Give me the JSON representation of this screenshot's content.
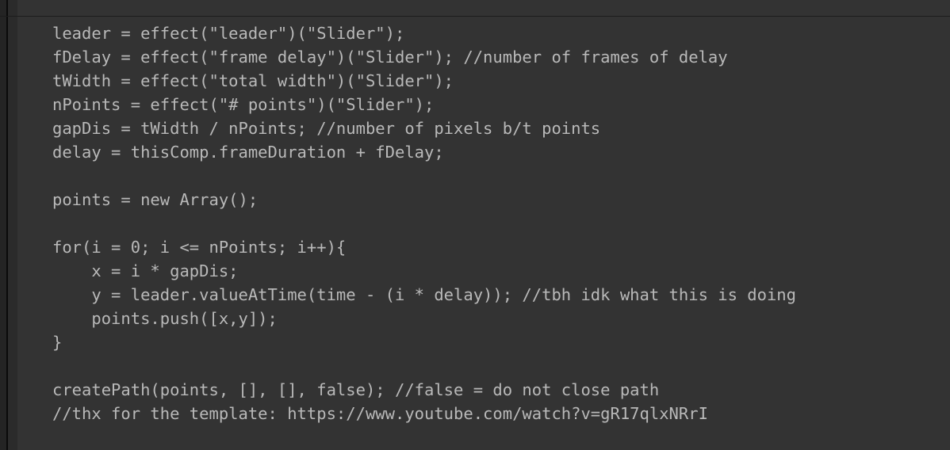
{
  "editor": {
    "language_hint": "after-effects-expression",
    "background_color": "#333333",
    "text_color": "#b9b9b9",
    "gutter_color": "#242424",
    "gutter_rule_color": "#0a0a0a",
    "gutter_inner_color": "#2b2b2b",
    "divider_color": "#1c1c1c",
    "lines": [
      "leader = effect(\"leader\")(\"Slider\");",
      "fDelay = effect(\"frame delay\")(\"Slider\"); //number of frames of delay",
      "tWidth = effect(\"total width\")(\"Slider\");",
      "nPoints = effect(\"# points\")(\"Slider\");",
      "gapDis = tWidth / nPoints; //number of pixels b/t points",
      "delay = thisComp.frameDuration + fDelay;",
      "",
      "points = new Array();",
      "",
      "for(i = 0; i <= nPoints; i++){",
      "    x = i * gapDis;",
      "    y = leader.valueAtTime(time - (i * delay)); //tbh idk what this is doing",
      "    points.push([x,y]);",
      "}",
      "",
      "createPath(points, [], [], false); //false = do not close path",
      "//thx for the template: https://www.youtube.com/watch?v=gR17qlxNRrI"
    ]
  }
}
